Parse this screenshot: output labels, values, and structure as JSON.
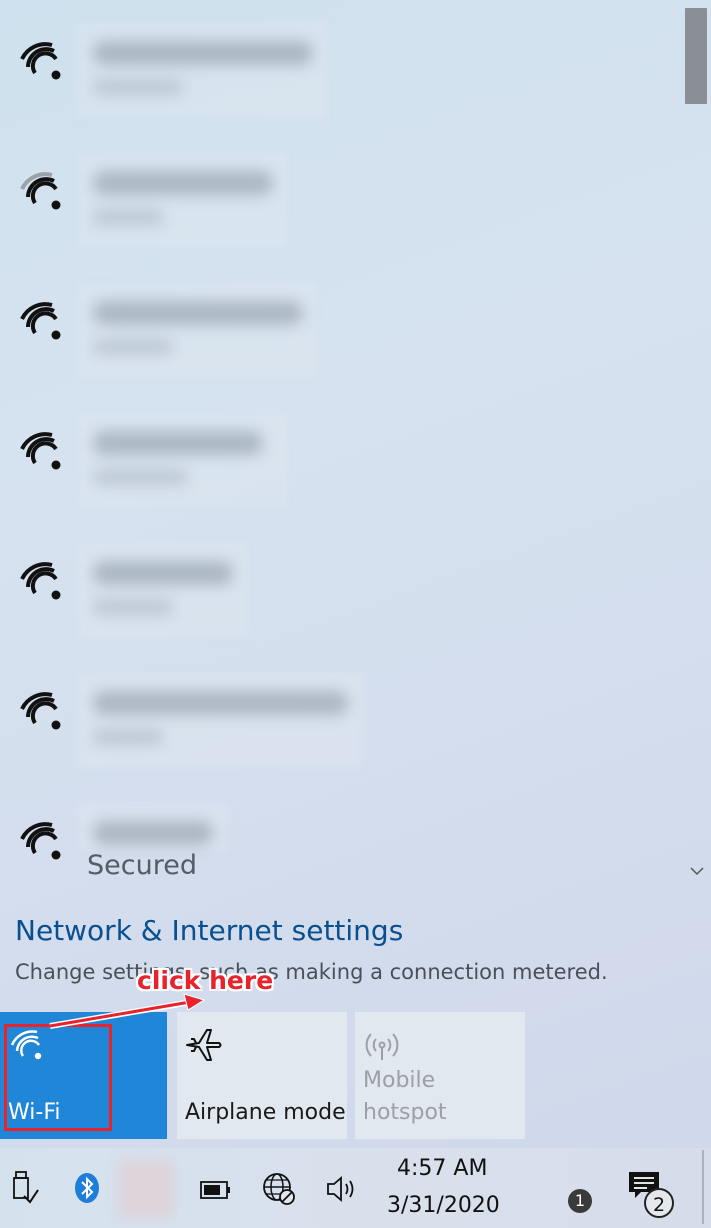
{
  "network_list": {
    "items": [
      {
        "signal": "full",
        "label_1_width": 220,
        "label_2_width": 90
      },
      {
        "signal": "medium",
        "label_1_width": 180,
        "label_2_width": 70
      },
      {
        "signal": "full",
        "label_1_width": 210,
        "label_2_width": 80
      },
      {
        "signal": "full",
        "label_1_width": 170,
        "label_2_width": 95
      },
      {
        "signal": "full",
        "label_1_width": 140,
        "label_2_width": 80
      },
      {
        "signal": "full",
        "label_1_width": 255,
        "label_2_width": 70
      },
      {
        "signal": "full",
        "label_1_width": 120,
        "label_2_width": 0
      }
    ],
    "last_item_status": "Secured"
  },
  "settings": {
    "link_label": "Network & Internet settings",
    "description": "Change settings, such as making a connection metered."
  },
  "annotation": {
    "text": "click here",
    "color": "#e8232b"
  },
  "quick_actions": {
    "wifi": {
      "label": "Wi-Fi",
      "icon": "wifi-icon",
      "active": true
    },
    "airplane": {
      "label": "Airplane mode",
      "icon": "airplane-icon",
      "active": false
    },
    "hotspot": {
      "label_line1": "Mobile",
      "label_line2": "hotspot",
      "icon": "mobile-hotspot-icon",
      "active": false,
      "disabled": true
    }
  },
  "taskbar": {
    "time": "4:57 AM",
    "date": "3/31/2020",
    "icons": [
      "usb-eject-icon",
      "bluetooth-icon",
      "battery-icon",
      "network-globe-icon",
      "volume-icon"
    ],
    "badge_1": "1",
    "notifications_badge": "2"
  },
  "colors": {
    "accent": "#1f86d8",
    "link": "#0a4f8f"
  }
}
